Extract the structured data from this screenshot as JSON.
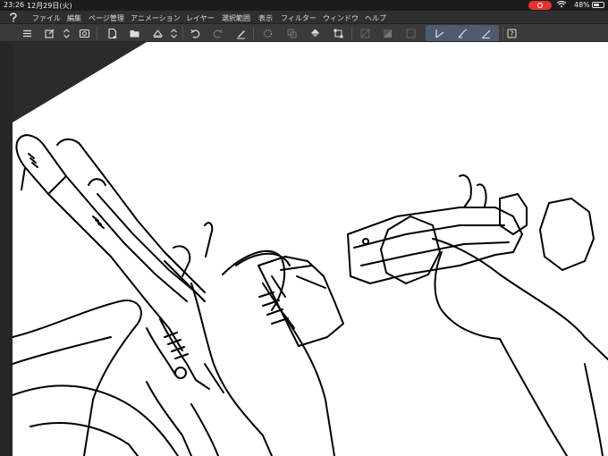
{
  "status": {
    "time": "23:26",
    "date": "12月29日(火)",
    "battery_percent": "48%",
    "battery_level": 0.48,
    "recording": true
  },
  "menu": {
    "items": [
      "ファイル",
      "編集",
      "ページ管理",
      "アニメーション",
      "レイヤー",
      "選択範囲",
      "表示",
      "フィルター",
      "ウィンドウ",
      "ヘルプ"
    ]
  },
  "toolbar": {
    "buttons": [
      "menu-icon",
      "new-canvas-icon",
      "layer-switch-icon",
      "onion-icon",
      "new-page-icon",
      "open-folder-icon",
      "save-icon",
      "stepper-icon",
      "undo-icon",
      "redo-icon",
      "clear-icon",
      "autoselect-icon",
      "copy-layer-icon",
      "fill-icon",
      "transform-icon",
      "snap-off-icon",
      "snap-ruler-icon",
      "snap-grid-icon",
      "pen-stabilizer-1-icon",
      "pen-stabilizer-2-icon",
      "pen-stabilizer-3-icon",
      "help-icon"
    ]
  },
  "colors": {
    "status_bg": "#1c1c1c",
    "menu_bg": "#2f2f2f",
    "toolbar_bg": "#3a3a3a",
    "pen_group_bg": "#4f5a6e",
    "canvas_bg": "#ffffff",
    "workspace_bg": "#2b2b2b",
    "record": "#e0342f"
  }
}
